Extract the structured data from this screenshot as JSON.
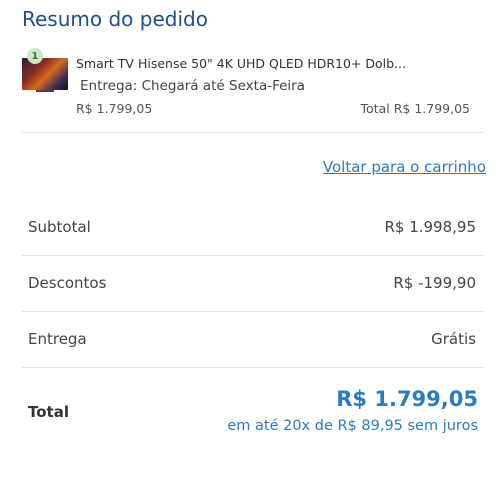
{
  "header": {
    "title": "Resumo do pedido"
  },
  "item": {
    "quantity": "1",
    "name": "Smart TV Hisense 50\" 4K UHD QLED HDR10+ Dolb...",
    "delivery": "Entrega: Chegará até Sexta-Feira",
    "price": "R$ 1.799,05",
    "total": "Total  R$ 1.799,05"
  },
  "back_link": "Voltar para o carrinho",
  "summary": {
    "subtotal_label": "Subtotal",
    "subtotal_value": "R$ 1.998,95",
    "discount_label": "Descontos",
    "discount_value": "R$ -199,90",
    "shipping_label": "Entrega",
    "shipping_value": "Grátis",
    "total_label": "Total",
    "total_value": "R$ 1.799,05",
    "installments": "em até 20x de R$ 89,95 sem juros"
  },
  "colors": {
    "title": "#1d4f8a",
    "accent": "#2a7bbf",
    "badge": "#cde8c9"
  },
  "icons": {
    "product_thumbnail": "tv-thumbnail-image"
  }
}
